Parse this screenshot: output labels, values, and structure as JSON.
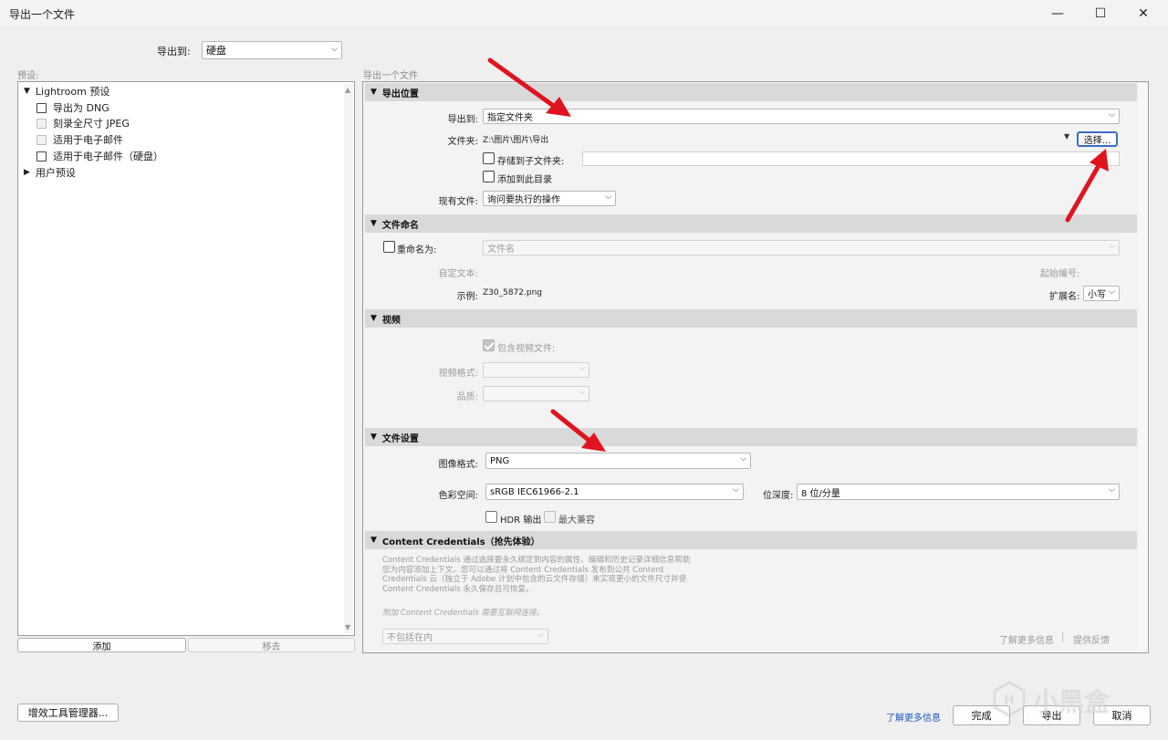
{
  "window": {
    "title": "导出一个文件",
    "minimize_glyph": "—",
    "maximize_glyph": "☐",
    "close_glyph": "✕"
  },
  "top": {
    "export_to_label": "导出到:",
    "export_to_value": "硬盘"
  },
  "presets": {
    "header": "预设:",
    "items": [
      {
        "label": "Lightroom 预设",
        "type": "group",
        "expanded": true
      },
      {
        "label": "导出为 DNG",
        "type": "item"
      },
      {
        "label": "刻录全尺寸 JPEG",
        "type": "item"
      },
      {
        "label": "适用于电子邮件",
        "type": "item"
      },
      {
        "label": "适用于电子邮件（硬盘）",
        "type": "item"
      },
      {
        "label": "用户预设",
        "type": "group",
        "expanded": false
      }
    ],
    "add_button": "添加",
    "remove_button": "移去"
  },
  "main_header": "导出一个文件",
  "export_location": {
    "title": "导出位置",
    "export_to_label": "导出到:",
    "export_to_value": "指定文件夹",
    "folder_label": "文件夹:",
    "folder_value": "Z:\\图片\\图片\\导出",
    "choose_button": "选择...",
    "subfolder_label": "存储到子文件夹:",
    "subfolder_value": "",
    "add_to_catalog_label": "添加到此目录",
    "existing_files_label": "现有文件:",
    "existing_files_value": "询问要执行的操作"
  },
  "file_naming": {
    "title": "文件命名",
    "rename_label": "重命名为:",
    "rename_value": "文件名",
    "custom_text_label": "自定文本:",
    "start_number_label": "起始编号:",
    "example_label": "示例:",
    "example_value": "Z30_5872.png",
    "extension_label": "扩展名:",
    "extension_value": "小写"
  },
  "video": {
    "title": "视频",
    "include_video_label": "包含视频文件:",
    "video_format_label": "视频格式:",
    "quality_label": "品质:"
  },
  "file_settings": {
    "title": "文件设置",
    "image_format_label": "图像格式:",
    "image_format_value": "PNG",
    "color_space_label": "色彩空间:",
    "color_space_value": "sRGB IEC61966-2.1",
    "bit_depth_label": "位深度:",
    "bit_depth_value": "8 位/分量",
    "hdr_label": "HDR 输出",
    "max_compat_label": "最大兼容"
  },
  "content_credentials": {
    "title": "Content Credentials（抢先体验）",
    "desc_lines": [
      "Content Credentials 通过选择要永久绑定到内容的属性、编辑和历史记录详细信息帮助",
      "您为内容添加上下文。您可以通过将 Content Credentials 发布到公共 Content",
      "Credentials 云（独立于 Adobe 计划中包含的云文件存储）来实现更小的文件尺寸并使",
      "Content Credentials 永久保存且可恢复。"
    ],
    "note": "附加 Content Credentials 需要互联网连接。",
    "include_value": "不包括在内",
    "learn_more": "了解更多信息",
    "separator": "|",
    "feedback": "提供反馈"
  },
  "footer": {
    "plugin_manager": "增效工具管理器...",
    "learn_more": "了解更多信息",
    "done": "完成",
    "export": "导出",
    "cancel": "取消",
    "watermark": "小黑盒"
  },
  "colors": {
    "annotation_arrow": "#e0141e",
    "link_blue": "#1a55c7"
  }
}
